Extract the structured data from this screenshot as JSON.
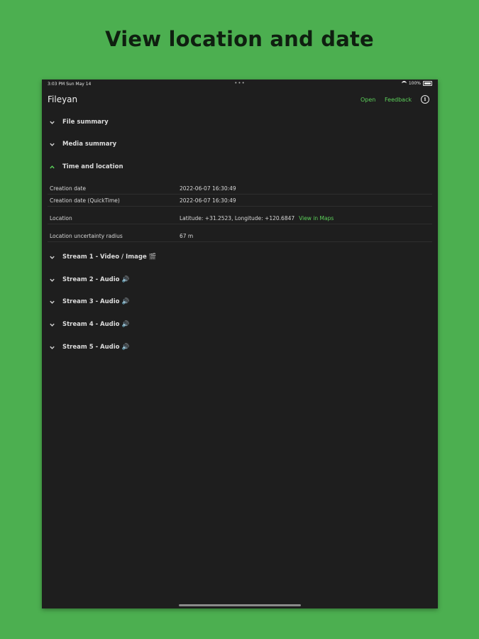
{
  "headline": "View location and date",
  "status_bar": {
    "time": "3:03 PM  Sun May 14",
    "battery": "100%"
  },
  "app": {
    "title": "Fileyan",
    "open_label": "Open",
    "feedback_label": "Feedback",
    "accent_color": "#5cd15a"
  },
  "sections": {
    "file_summary": "File summary",
    "media_summary": "Media summary",
    "time_location": "Time and location",
    "stream1": "Stream 1 - Video / Image 🎬",
    "stream2": "Stream 2 - Audio 🔊",
    "stream3": "Stream 3 - Audio 🔊",
    "stream4": "Stream 4 - Audio 🔊",
    "stream5": "Stream 5 - Audio 🔊"
  },
  "time_location": {
    "rows": [
      {
        "key": "Creation date",
        "value": "2022-06-07 16:30:49"
      },
      {
        "key": "Creation date (QuickTime)",
        "value": "2022-06-07 16:30:49"
      },
      {
        "key": "Location",
        "value": "Latitude: +31.2523, Longitude: +120.6847"
      },
      {
        "key": "Location uncertainty radius",
        "value": "67 m"
      }
    ],
    "maps_link": "View in Maps"
  }
}
